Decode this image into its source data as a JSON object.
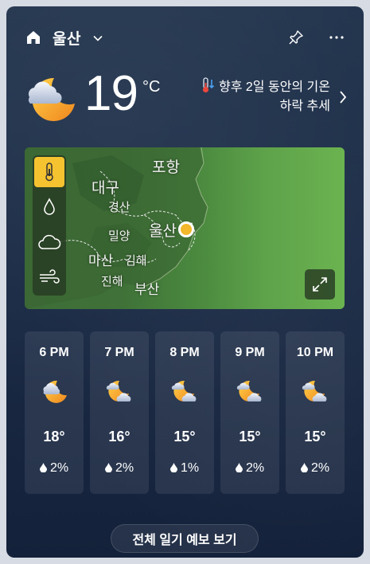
{
  "header": {
    "location": "울산",
    "icons": [
      "home-icon",
      "chevron-down-icon",
      "pin-icon",
      "more-icon"
    ]
  },
  "current": {
    "temperature": "19",
    "unit": "°C",
    "condition_icon": "moon-cloud-icon",
    "trend_line1": "향후 2일 동안의 기온",
    "trend_line2": "하락 추세",
    "trend_icon": "thermometer-down-icon"
  },
  "map": {
    "layers": [
      {
        "icon": "thermometer-icon",
        "active": true
      },
      {
        "icon": "drop-icon",
        "active": false
      },
      {
        "icon": "cloud-icon",
        "active": false
      },
      {
        "icon": "wind-icon",
        "active": false
      }
    ],
    "labels": {
      "pohang": "포항",
      "daegu": "대구",
      "gyeongsan": "경산",
      "miryang": "밀양",
      "ulsan": "울산",
      "masan": "마산",
      "gimhae": "김해",
      "jinhae": "진해",
      "busan": "부산"
    },
    "expand_icon": "expand-icon"
  },
  "hourly": [
    {
      "time": "6 PM",
      "temp": "18°",
      "precip": "2%",
      "icon": "moon-cloud-icon"
    },
    {
      "time": "7 PM",
      "temp": "16°",
      "precip": "2%",
      "icon": "moon-clouds-icon"
    },
    {
      "time": "8 PM",
      "temp": "15°",
      "precip": "1%",
      "icon": "moon-clouds-icon"
    },
    {
      "time": "9 PM",
      "temp": "15°",
      "precip": "2%",
      "icon": "moon-clouds-icon"
    },
    {
      "time": "10 PM",
      "temp": "15°",
      "precip": "2%",
      "icon": "moon-clouds-icon"
    }
  ],
  "footer": {
    "forecast_button": "전체 일기 예보 보기"
  },
  "colors": {
    "card_top": "#23354e",
    "card_bottom": "#14213a",
    "accent": "#f5c230",
    "moon": "#f5a623"
  }
}
